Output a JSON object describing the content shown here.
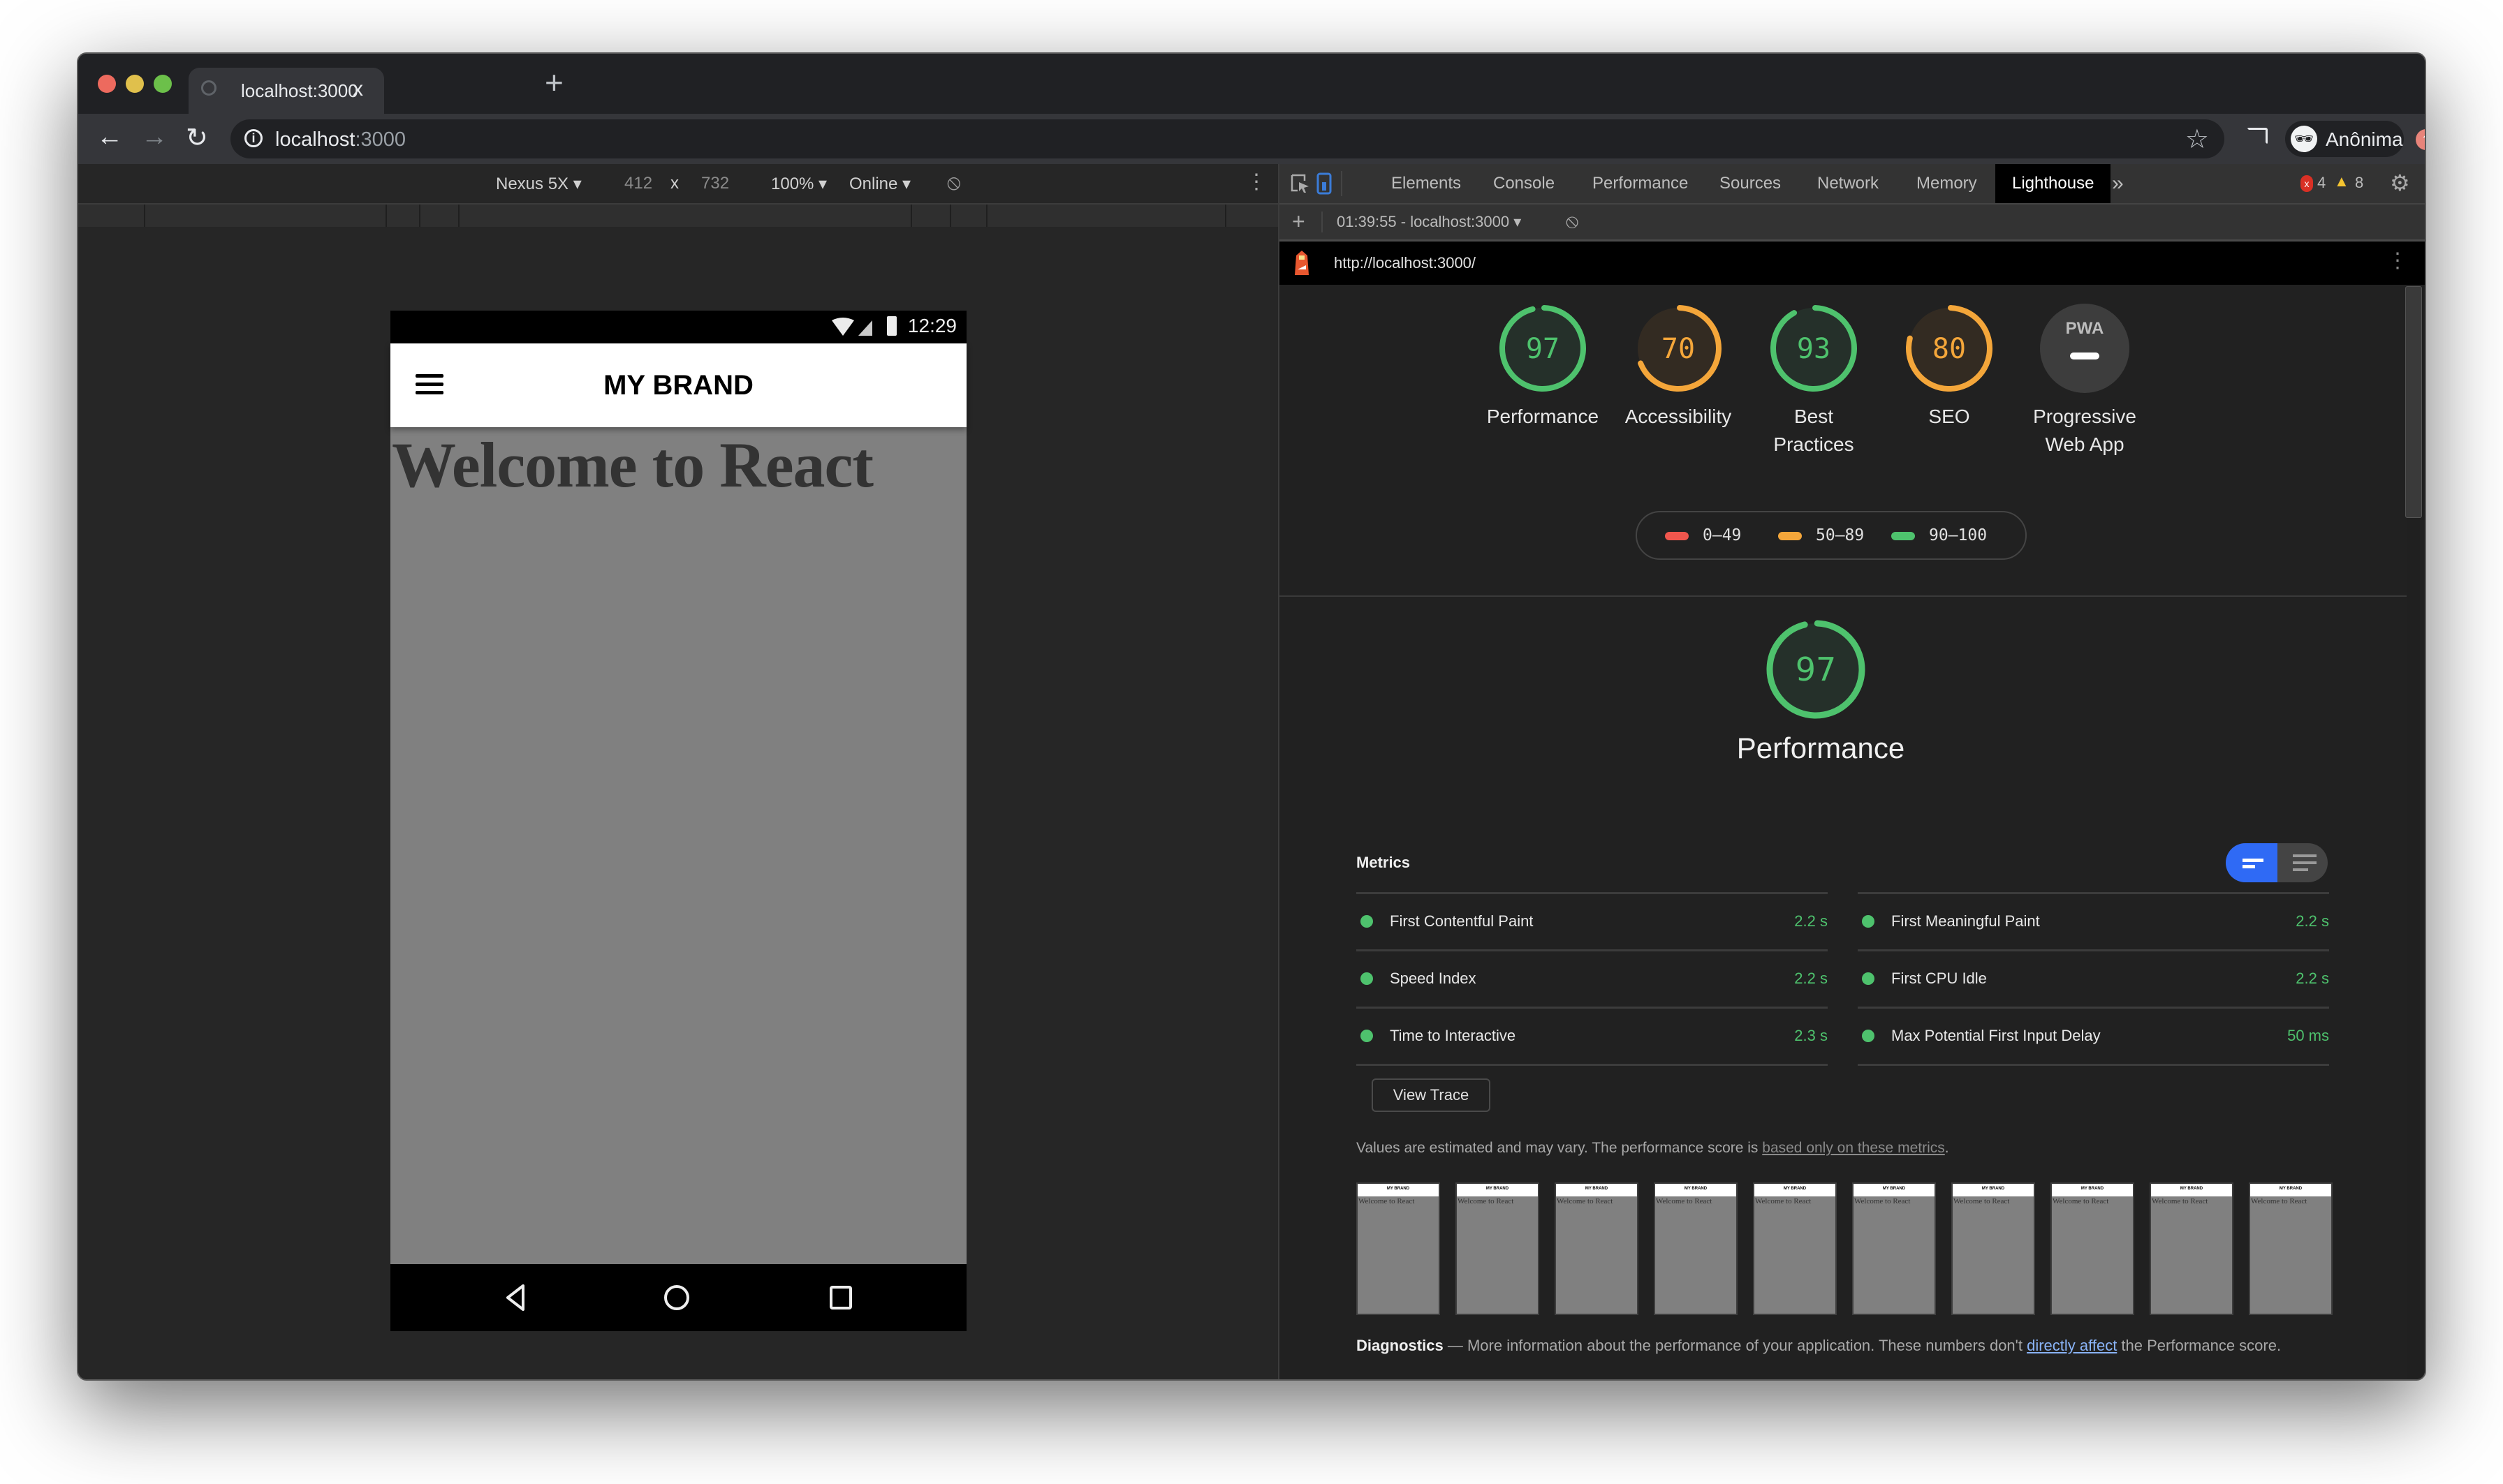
{
  "browser": {
    "tab": {
      "title": "localhost:3000",
      "close": "x"
    },
    "new_tab": "+",
    "address": {
      "host": "localhost",
      "port": ":3000"
    },
    "profile": {
      "name": "Anônima",
      "icon": "incognito-icon"
    },
    "nav": {
      "back": "←",
      "forward": "→",
      "reload": "↻"
    },
    "icons": {
      "star": "☆",
      "update": "⬆"
    }
  },
  "device_toolbar": {
    "device": "Nexus 5X",
    "width": "412",
    "times": "x",
    "height": "732",
    "zoom": "100%",
    "throttle": "Online",
    "more": "⋮"
  },
  "phone": {
    "time": "12:29",
    "brand": "MY BRAND",
    "heading": "Welcome to React"
  },
  "devtools": {
    "tabs": [
      {
        "label": "Elements"
      },
      {
        "label": "Console"
      },
      {
        "label": "Performance"
      },
      {
        "label": "Sources"
      },
      {
        "label": "Network"
      },
      {
        "label": "Memory"
      },
      {
        "label": "Lighthouse",
        "active": true
      }
    ],
    "overflow": "»",
    "errors": "4",
    "warnings": "8",
    "report_selector": "01:39:55 - localhost:3000",
    "report_url": "http://localhost:3000/",
    "add": "+"
  },
  "lighthouse": {
    "categories": [
      {
        "label": "Performance",
        "score": 97,
        "color": "#4ec26d"
      },
      {
        "label": "Accessibility",
        "score": 70,
        "color": "#f4a63a"
      },
      {
        "label": "Best Practices",
        "score": 93,
        "color": "#4ec26d"
      },
      {
        "label": "SEO",
        "score": 80,
        "color": "#f4a63a"
      },
      {
        "label": "Progressive Web App",
        "score": null,
        "badge": "PWA"
      }
    ],
    "legend": [
      {
        "range": "0–49",
        "color": "#f0564d"
      },
      {
        "range": "50–89",
        "color": "#f4a63a"
      },
      {
        "range": "90–100",
        "color": "#4ec26d"
      }
    ],
    "performance": {
      "score": 97,
      "title": "Performance",
      "metrics_title": "Metrics",
      "metrics": [
        {
          "name": "First Contentful Paint",
          "value": "2.2 s"
        },
        {
          "name": "First Meaningful Paint",
          "value": "2.2 s"
        },
        {
          "name": "Speed Index",
          "value": "2.2 s"
        },
        {
          "name": "First CPU Idle",
          "value": "2.2 s"
        },
        {
          "name": "Time to Interactive",
          "value": "2.3 s"
        },
        {
          "name": "Max Potential First Input Delay",
          "value": "50 ms"
        }
      ],
      "view_trace": "View Trace",
      "note_prefix": "Values are estimated and may vary. The performance score is ",
      "note_link": "based only on these metrics",
      "note_suffix": ".",
      "filmstrip": {
        "frame_count": 10,
        "frame_brand": "MY BRAND",
        "frame_heading": "Welcome to React"
      }
    },
    "diagnostics": {
      "title": "Diagnostics",
      "dash": "—",
      "text": "More information about the performance of your application. These numbers don't ",
      "link": "directly affect",
      "suffix": " the Performance score."
    }
  }
}
